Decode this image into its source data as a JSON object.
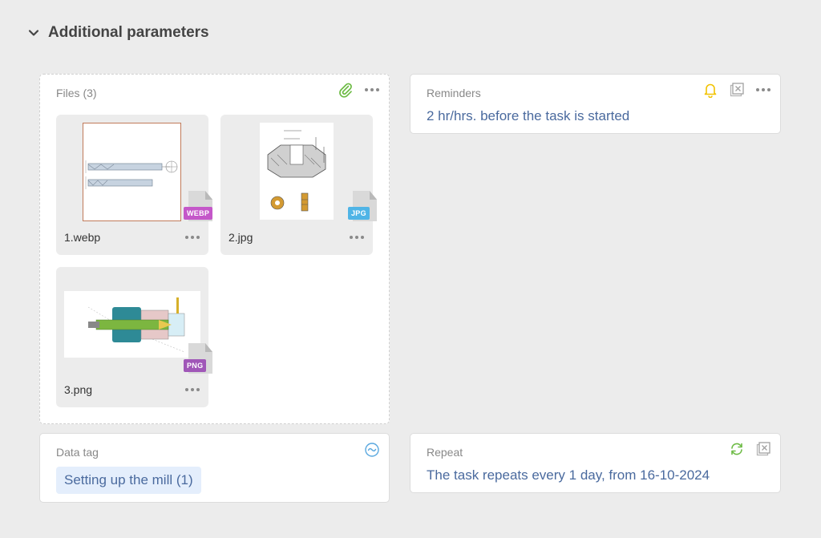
{
  "section": {
    "title": "Additional parameters",
    "icon": "chevron-down-icon"
  },
  "files": {
    "label": "Files (3)",
    "items": [
      {
        "name": "1.webp",
        "ext": "WEBP",
        "ext_color": "#c457c9"
      },
      {
        "name": "2.jpg",
        "ext": "JPG",
        "ext_color": "#4fb4e6"
      },
      {
        "name": "3.png",
        "ext": "PNG",
        "ext_color": "#a057b8"
      }
    ]
  },
  "reminders": {
    "label": "Reminders",
    "value": "2 hr/hrs. before the task is started"
  },
  "data_tag": {
    "label": "Data tag",
    "chip": "Setting up the mill (1)"
  },
  "repeat": {
    "label": "Repeat",
    "value": "The task repeats every 1 day, from 16-10-2024"
  },
  "colors": {
    "accent_text": "#4a6a9e",
    "clip": "#6dbb45",
    "bell": "#f2c200",
    "repeat": "#6dbb45",
    "tag_icon": "#5aa8df",
    "chip_bg": "#e4eefc"
  }
}
